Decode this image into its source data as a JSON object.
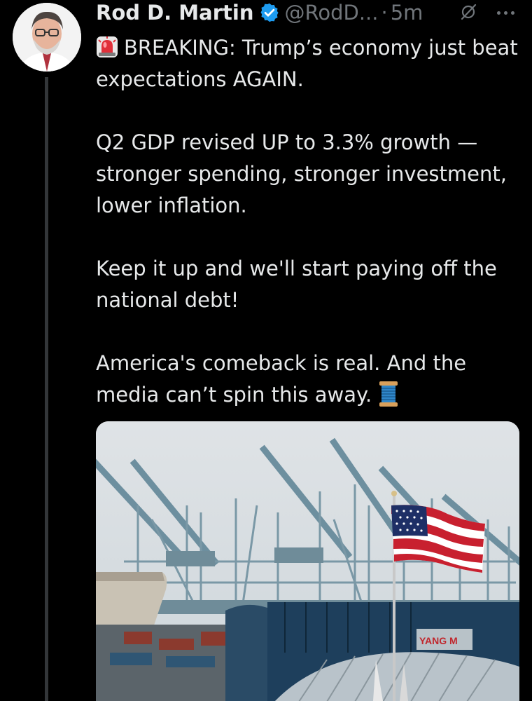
{
  "tweet": {
    "author_name": "Rod D. Martin",
    "handle": "@RodD...",
    "separator": "·",
    "time": "5m",
    "paragraphs": [
      "BREAKING: Trump’s economy just beat expectations AGAIN.",
      "Q2 GDP revised UP to 3.3% growth — stronger spending, stronger investment, lower inflation.",
      "Keep it up and we'll start paying off the national debt!",
      "America's comeback is real. And the media can’t spin this away."
    ],
    "leading_emoji": "police-car-light-icon",
    "trailing_emoji": "spool-of-thread-icon",
    "verified": true
  },
  "media": {
    "description_icon": "port-cranes-flag-photo",
    "sign_text": "YANG M"
  },
  "colors": {
    "background": "#000000",
    "text": "#e7e9ea",
    "secondary": "#71767b",
    "verified": "#1d9bf0"
  }
}
